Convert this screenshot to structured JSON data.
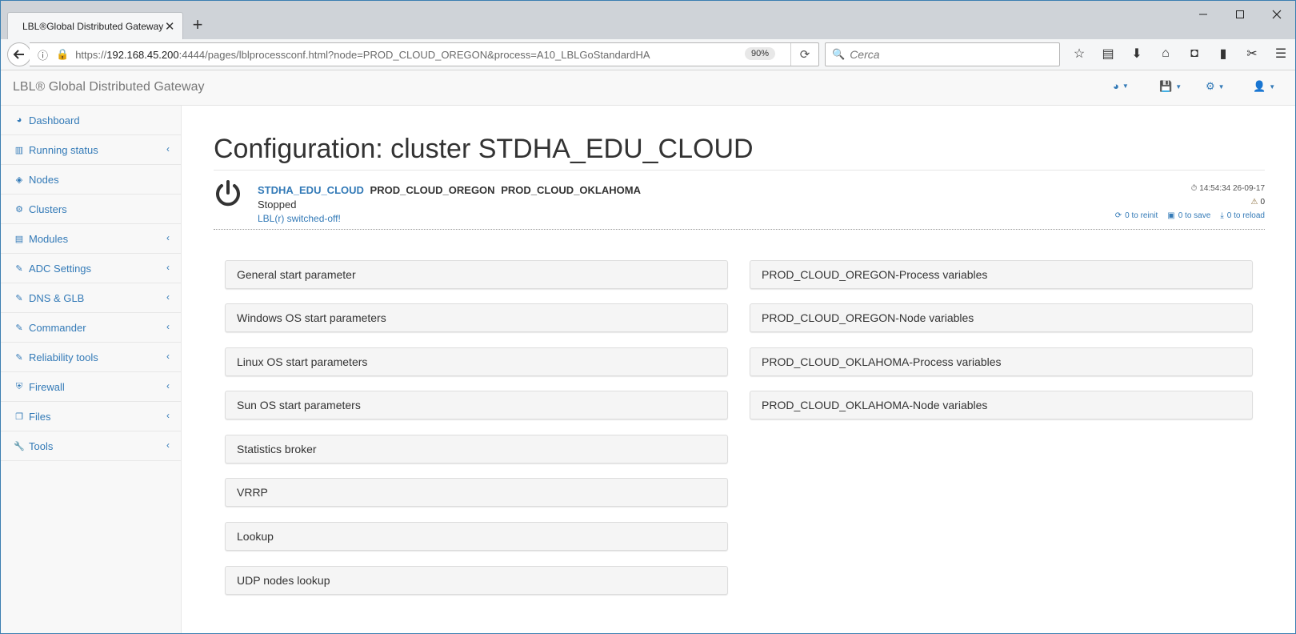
{
  "browser": {
    "tab_title": "LBL®Global Distributed Gateway",
    "tab_close": "✕",
    "new_tab": "+",
    "url_prefix": "https://",
    "url_host": "192.168.45.200",
    "url_rest": ":4444/pages/lblprocessconf.html?node=PROD_CLOUD_OREGON&process=A10_LBLGoStandardHA",
    "zoom": "90%",
    "search_placeholder": "Cerca"
  },
  "app": {
    "brand": "LBL® Global Distributed Gateway"
  },
  "sidebar": {
    "items": [
      {
        "label": "Dashboard",
        "icon": "dashboard-icon",
        "has_submenu": false
      },
      {
        "label": "Running status",
        "icon": "bar-chart-icon",
        "has_submenu": true
      },
      {
        "label": "Nodes",
        "icon": "cube-icon",
        "has_submenu": false
      },
      {
        "label": "Clusters",
        "icon": "cogs-icon",
        "has_submenu": false
      },
      {
        "label": "Modules",
        "icon": "list-icon",
        "has_submenu": true
      },
      {
        "label": "ADC Settings",
        "icon": "edit-icon",
        "has_submenu": true
      },
      {
        "label": "DNS & GLB",
        "icon": "edit-icon",
        "has_submenu": true
      },
      {
        "label": "Commander",
        "icon": "edit-icon",
        "has_submenu": true
      },
      {
        "label": "Reliability tools",
        "icon": "edit-icon",
        "has_submenu": true
      },
      {
        "label": "Firewall",
        "icon": "shield-icon",
        "has_submenu": true
      },
      {
        "label": "Files",
        "icon": "files-icon",
        "has_submenu": true
      },
      {
        "label": "Tools",
        "icon": "wrench-icon",
        "has_submenu": true
      }
    ]
  },
  "main": {
    "title": "Configuration: cluster STDHA_EDU_CLOUD",
    "status": {
      "cluster": "STDHA_EDU_CLOUD",
      "node1": "PROD_CLOUD_OREGON",
      "node2": "PROD_CLOUD_OKLAHOMA",
      "state": "Stopped",
      "note": "LBL(r) switched-off!",
      "timestamp": "14:54:34 26-09-17",
      "warnings": "0",
      "reinit": "0 to reinit",
      "save": "0 to save",
      "reload": "0 to reload"
    },
    "left_panels": [
      "General start parameter",
      "Windows OS start parameters",
      "Linux OS start parameters",
      "Sun OS start parameters",
      "Statistics broker",
      "VRRP",
      "Lookup",
      "UDP nodes lookup"
    ],
    "right_panels": [
      "PROD_CLOUD_OREGON-Process variables",
      "PROD_CLOUD_OREGON-Node variables",
      "PROD_CLOUD_OKLAHOMA-Process variables",
      "PROD_CLOUD_OKLAHOMA-Node variables"
    ]
  },
  "colors": {
    "accent": "#337ab7",
    "window_border": "#3c7fb1",
    "panel_bg": "#f5f5f5"
  }
}
